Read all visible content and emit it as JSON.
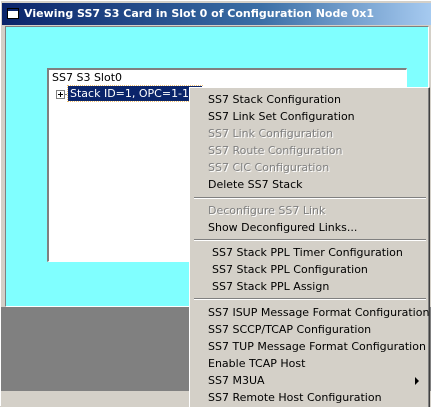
{
  "window": {
    "title": "Viewing SS7 S3 Card in Slot 0 of Configuration Node 0x1",
    "icon": "window-icon"
  },
  "tree": {
    "root_label": "SS7 S3 Slot0",
    "selected_node_label": "Stack ID=1, OPC=1-1-1",
    "expander_icon": "plus-box-icon"
  },
  "context_menu": {
    "group1": [
      {
        "label": "SS7 Stack Configuration",
        "enabled": true
      },
      {
        "label": "SS7 Link Set Configuration",
        "enabled": true
      },
      {
        "label": "SS7 Link Configuration",
        "enabled": false
      },
      {
        "label": "SS7 Route Configuration",
        "enabled": false
      },
      {
        "label": "SS7 CIC Configuration",
        "enabled": false
      },
      {
        "label": "Delete SS7 Stack",
        "enabled": true
      }
    ],
    "group2": [
      {
        "label": "Deconfigure SS7 Link",
        "enabled": false
      },
      {
        "label": "Show Deconfigured Links...",
        "enabled": true
      }
    ],
    "group3": [
      {
        "label": "SS7 Stack PPL Timer Configuration",
        "enabled": true
      },
      {
        "label": "SS7 Stack PPL Configuration",
        "enabled": true
      },
      {
        "label": "SS7 Stack PPL Assign",
        "enabled": true
      }
    ],
    "group4": [
      {
        "label": "SS7 ISUP Message Format Configuration",
        "enabled": true
      },
      {
        "label": "SS7 SCCP/TCAP Configuration",
        "enabled": true
      },
      {
        "label": "SS7 TUP Message Format Configuration",
        "enabled": true
      },
      {
        "label": "Enable TCAP Host",
        "enabled": true
      },
      {
        "label": "SS7 M3UA",
        "enabled": true,
        "submenu": true,
        "icon": "chevron-right-icon"
      },
      {
        "label": "SS7 Remote Host Configuration",
        "enabled": true
      }
    ]
  },
  "colors": {
    "client_background": "#80ffff",
    "selection": "#0a246a",
    "face": "#d4d0c8",
    "dark_panel": "#808080"
  }
}
